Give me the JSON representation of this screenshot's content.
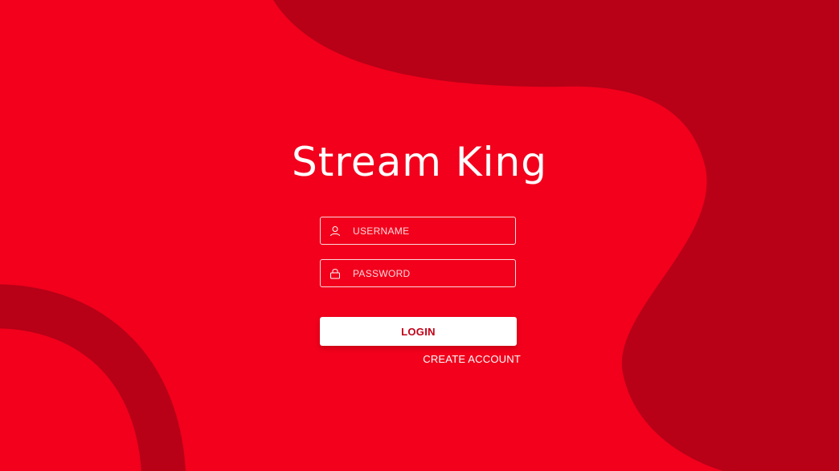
{
  "app": {
    "title": "Stream King"
  },
  "login_form": {
    "username": {
      "placeholder": "USERNAME",
      "value": "",
      "icon": "user-icon"
    },
    "password": {
      "placeholder": "PASSWORD",
      "value": "",
      "icon": "lock-icon"
    },
    "login_label": "LOGIN",
    "create_account_label": "CREATE ACCOUNT"
  },
  "colors": {
    "background": "#f2001c",
    "background_shape": "#b80017",
    "accent_text": "#c10017",
    "text": "#ffffff"
  }
}
